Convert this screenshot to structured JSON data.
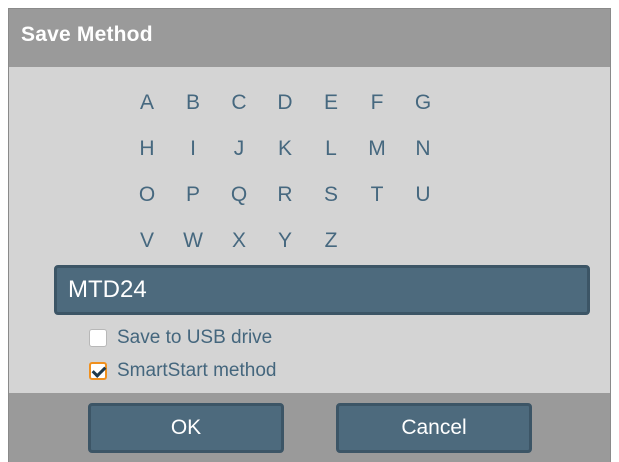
{
  "dialog": {
    "title": "Save Method"
  },
  "keyboard": {
    "rows": [
      [
        "A",
        "B",
        "C",
        "D",
        "E",
        "F",
        "G"
      ],
      [
        "H",
        "I",
        "J",
        "K",
        "L",
        "M",
        "N"
      ],
      [
        "O",
        "P",
        "Q",
        "R",
        "S",
        "T",
        "U"
      ],
      [
        "V",
        "W",
        "X",
        "Y",
        "Z"
      ]
    ]
  },
  "name_field": {
    "value": "MTD24"
  },
  "options": {
    "save_to_usb": {
      "label": "Save to USB drive",
      "checked": false
    },
    "smartstart": {
      "label": "SmartStart method",
      "checked": true
    }
  },
  "buttons": {
    "ok_label": "OK",
    "cancel_label": "Cancel"
  },
  "colors": {
    "key_text": "#46687f",
    "field_bg": "#4d6a7d",
    "focus_accent": "#f0901e",
    "dialog_bg": "#d4d4d4",
    "bar_bg": "#9a9a9a"
  }
}
